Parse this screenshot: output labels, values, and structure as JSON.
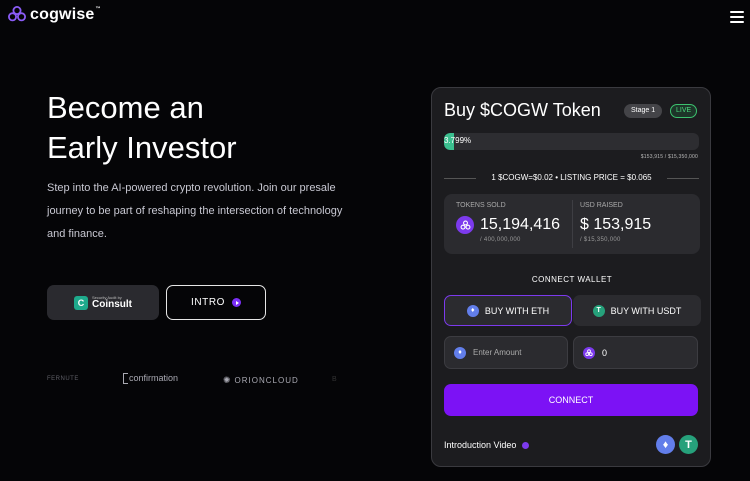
{
  "header": {
    "brand": "cogwise",
    "brand_tm": "™"
  },
  "hero": {
    "title_line1": "Become an",
    "title_line2": "Early Investor",
    "description": "Step into the AI-powered crypto revolution. Join our presale journey to be part of reshaping the intersection of technology and finance."
  },
  "actions": {
    "audit_small": "Security Audit by",
    "audit_name": "Coinsult",
    "intro_label": "INTRO"
  },
  "partners": [
    "FERNUTE",
    "confirmation",
    "ORIONCLOUD",
    "B"
  ],
  "widget": {
    "title": "Buy $COGW Token",
    "stage": "Stage 1",
    "live": "LIVE",
    "progress_text": "3.799%",
    "progress_fraction": 0.03799,
    "progress_sub": "$153,915 / $15,350,000",
    "rate": "1 $COGW=$0.02  •  LISTING PRICE = $0.065",
    "tokens_sold_label": "TOKENS SOLD",
    "tokens_sold_value": "15,194,416",
    "tokens_sold_total": "/ 400,000,000",
    "usd_raised_label": "USD RAISED",
    "usd_raised_value": "$ 153,915",
    "usd_raised_total": "/ $15,350,000",
    "connect_wallet_label": "CONNECT WALLET",
    "buy_eth_label": "BUY WITH ETH",
    "buy_usdt_label": "BUY WITH USDT",
    "amount_placeholder": "Enter Amount",
    "receive_value": "0",
    "connect_button": "CONNECT",
    "video_label": "Introduction Video"
  },
  "colors": {
    "accent": "#7c12f5",
    "progress": "#3bbf8f",
    "live": "#4cd97e"
  }
}
